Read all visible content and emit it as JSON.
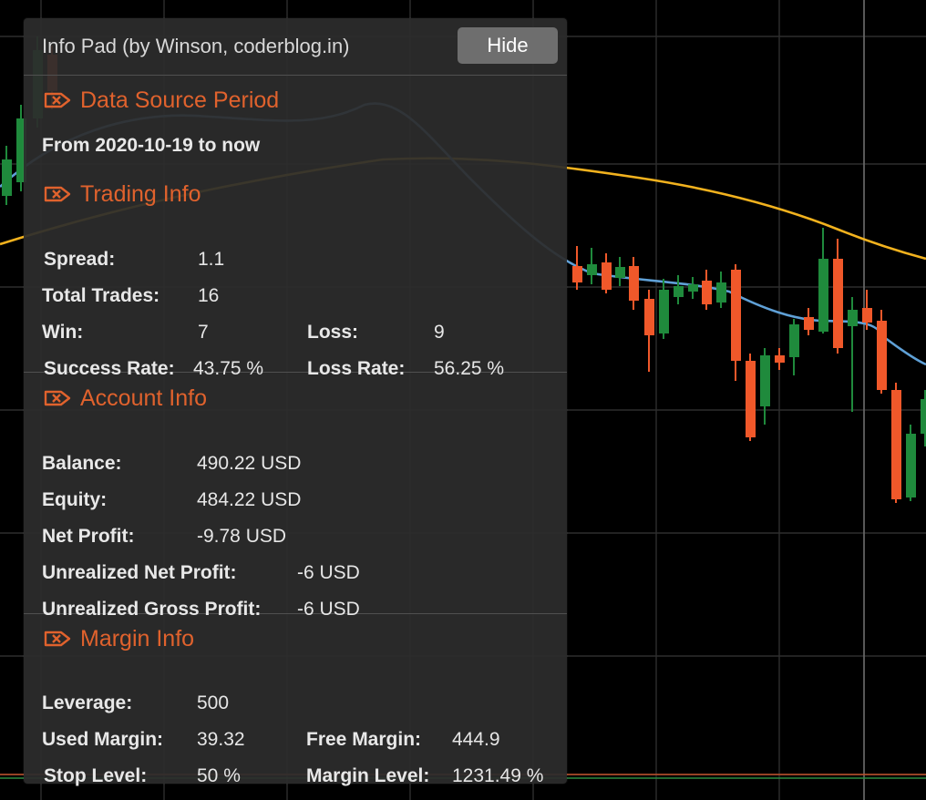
{
  "panel": {
    "title": "Info Pad (by Winson, coderblog.in)",
    "hide_label": "Hide"
  },
  "sections": {
    "data_source": {
      "title": "Data Source Period",
      "period": "From 2020-10-19 to now"
    },
    "trading": {
      "title": "Trading Info",
      "spread_label": "Spread:",
      "spread": "1.1",
      "total_trades_label": "Total Trades:",
      "total_trades": "16",
      "win_label": "Win:",
      "win": "7",
      "loss_label": "Loss:",
      "loss": "9",
      "success_rate_label": "Success Rate:",
      "success_rate": "43.75 %",
      "loss_rate_label": "Loss Rate:",
      "loss_rate": "56.25 %"
    },
    "account": {
      "title": "Account Info",
      "balance_label": "Balance:",
      "balance": "490.22 USD",
      "equity_label": "Equity:",
      "equity": "484.22 USD",
      "net_profit_label": "Net Profit:",
      "net_profit": "-9.78 USD",
      "unrealized_net_label": "Unrealized Net Profit:",
      "unrealized_net": "-6 USD",
      "unrealized_gross_label": "Unrealized Gross Profit:",
      "unrealized_gross": "-6 USD"
    },
    "margin": {
      "title": "Margin Info",
      "leverage_label": "Leverage:",
      "leverage": "500",
      "used_margin_label": "Used Margin:",
      "used_margin": "39.32",
      "free_margin_label": "Free Margin:",
      "free_margin": "444.9",
      "stop_level_label": "Stop Level:",
      "stop_level": "50 %",
      "margin_level_label": "Margin Level:",
      "margin_level": "1231.49 %"
    }
  },
  "colors": {
    "accent": "#e0622d",
    "up_candle": "#1f8a3c",
    "down_candle": "#f0582a",
    "slow_ma": "#f2b21e",
    "fast_ma": "#5fa0d6",
    "grid": "#2e2e2e"
  }
}
